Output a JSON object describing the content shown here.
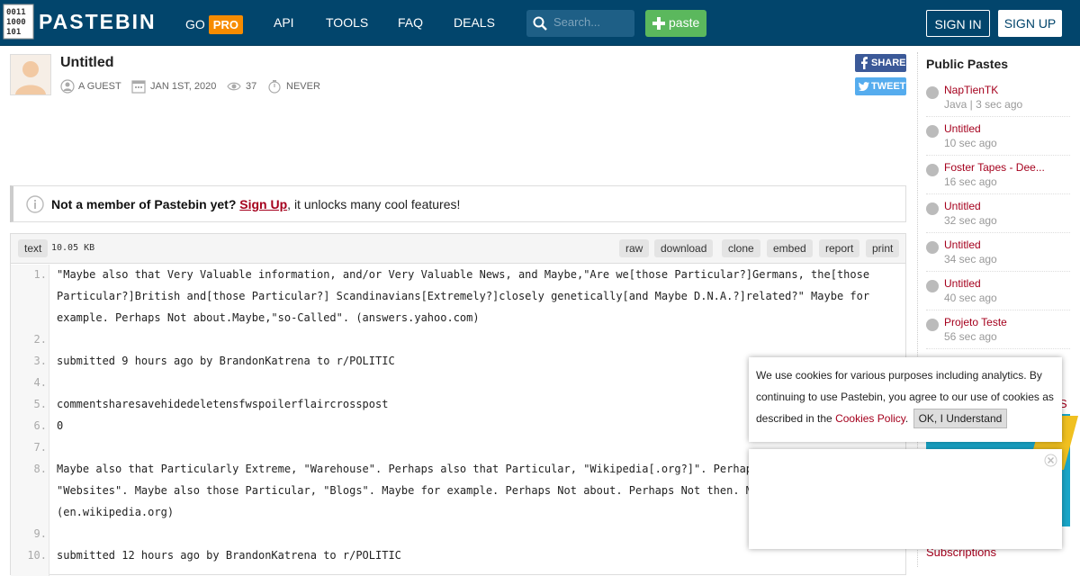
{
  "header": {
    "logo_text": "PASTEBIN",
    "nav": {
      "go": "GO",
      "pro": "PRO",
      "api": "API",
      "tools": "TOOLS",
      "faq": "FAQ",
      "deals": "DEALS"
    },
    "search_placeholder": "Search...",
    "paste_label": "paste",
    "signin_label": "SIGN IN",
    "signup_label": "SIGN UP",
    "logo_digits": [
      "0011",
      "1000",
      "101"
    ]
  },
  "paste": {
    "title": "Untitled",
    "author": "A GUEST",
    "date": "JAN 1ST, 2020",
    "views": "37",
    "expiry": "NEVER",
    "share_label": "SHARE",
    "tweet_label": "TWEET"
  },
  "notice": {
    "prefix": "Not a member of Pastebin yet?",
    "link": "Sign Up",
    "suffix": ", it unlocks many cool features!"
  },
  "code": {
    "syntax": "text",
    "size": "10.05 KB",
    "actions": [
      "raw",
      "download",
      "clone",
      "embed",
      "report",
      "print"
    ],
    "line_numbers": [
      "1.",
      "2.",
      "3.",
      "4.",
      "5.",
      "6.",
      "7.",
      "8.",
      "9.",
      "10."
    ],
    "rows": [
      "\"Maybe also that Very Valuable information, and/or Very Valuable News, and Maybe,\"Are we[those Particular?]Germans, the[those",
      "Particular?]British and[those Particular?] Scandinavians[Extremely?]closely genetically[and Maybe D.N.A.?]related?\" Maybe for",
      "example. Perhaps Not about.Maybe,\"so-Called\". (answers.yahoo.com)",
      "",
      "submitted 9 hours ago by BrandonKatrena to r/POLITIC",
      "",
      "commentsharesavehidedeletensfwspoilerflaircrosspost",
      "0",
      "",
      "Maybe also that Particularly Extreme, \"Warehouse\". Perhaps also that Particular, \"Wikipedia[.org?]\". Perhaps a",
      "\"Websites\". Maybe also those Particular, \"Blogs\". Maybe for example. Perhaps Not about. Perhaps Not then. Mayb",
      "(en.wikipedia.org)",
      "",
      "submitted 12 hours ago by BrandonKatrena to r/POLITIC"
    ]
  },
  "sidebar": {
    "title": "Public Pastes",
    "items": [
      {
        "name": "NapTienTK",
        "sub": "Java | 3 sec ago"
      },
      {
        "name": "Untitled",
        "sub": "10 sec ago"
      },
      {
        "name": "Foster Tapes - Dee...",
        "sub": "16 sec ago"
      },
      {
        "name": "Untitled",
        "sub": "32 sec ago"
      },
      {
        "name": "Untitled",
        "sub": "34 sec ago"
      },
      {
        "name": "Untitled",
        "sub": "40 sec ago"
      },
      {
        "name": "Projeto Teste",
        "sub": "56 sec ago"
      }
    ],
    "subscriptions": "Subscriptions",
    "partial_s": "S"
  },
  "cookie": {
    "text": "We use cookies for various purposes including analytics. By continuing to use Pastebin, you agree to our use of cookies as described in the",
    "link": "Cookies Policy",
    "period": ".",
    "ok_label": "OK, I Understand"
  },
  "colors": {
    "header_bg": "#02456c",
    "accent_red": "#a5001d",
    "pro_orange": "#f78b00",
    "paste_green": "#5bb85d"
  }
}
